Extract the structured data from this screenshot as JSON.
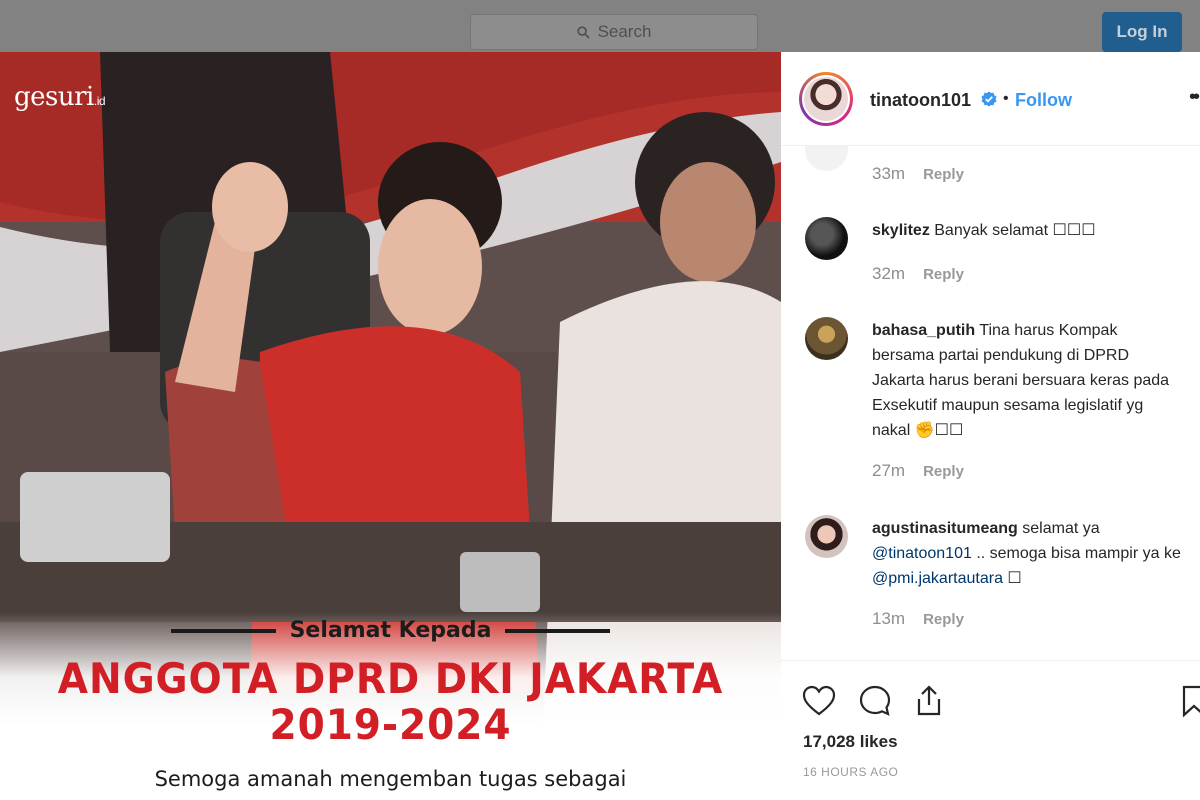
{
  "topbar": {
    "search_placeholder": "Search",
    "login_label": "Log In"
  },
  "photo": {
    "brand": "gesuri",
    "brand_suffix": ".id",
    "banner_intro": "Selamat Kepada",
    "headline_line1": "ANGGOTA DPRD DKI JAKARTA",
    "headline_line2": "2019-2024",
    "wish": "Semoga amanah mengemban tugas sebagai"
  },
  "post": {
    "username": "tinatoon101",
    "separator": "•",
    "follow_label": "Follow",
    "more_label": "••"
  },
  "comments": [
    {
      "username": "",
      "text": "",
      "time": "33m",
      "reply": "Reply"
    },
    {
      "username": "skylitez",
      "text": " Banyak selamat ☐☐☐",
      "time": "32m",
      "reply": "Reply"
    },
    {
      "username": "bahasa_putih",
      "text": " Tina harus Kompak bersama partai pendukung di DPRD Jakarta harus berani bersuara keras pada Exsekutif maupun sesama legislatif yg nakal ✊☐☐",
      "time": "27m",
      "reply": "Reply"
    },
    {
      "username": "agustinasitumeang",
      "text_before": " selamat ya ",
      "mention1": "@tinatoon101",
      "text_mid": " .. semoga bisa mampir ya ke ",
      "mention2": "@pmi.jakartautara",
      "text_after": " ☐",
      "time": "13m",
      "reply": "Reply"
    }
  ],
  "actions": {
    "likes": "17,028 likes",
    "posted": "16 HOURS AGO"
  },
  "colors": {
    "accent_blue": "#3897f0",
    "headline_red": "#d21f25",
    "verified_blue": "#3897f0"
  },
  "icons": [
    "search-icon",
    "verified-badge-icon",
    "heart-icon",
    "comment-icon",
    "share-icon",
    "bookmark-icon"
  ]
}
